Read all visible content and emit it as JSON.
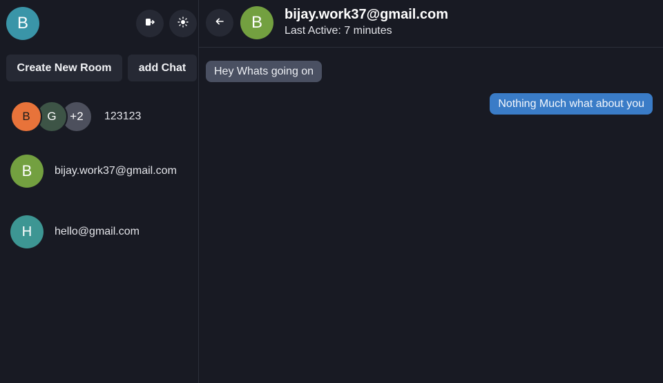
{
  "user": {
    "initial": "B"
  },
  "sidebar": {
    "create_room_label": "Create New Room",
    "add_chat_label": "add Chat",
    "group": {
      "avatars": [
        "B",
        "G",
        "+2"
      ],
      "name": "123123"
    },
    "chats": [
      {
        "initial": "B",
        "name": "bijay.work37@gmail.com"
      },
      {
        "initial": "H",
        "name": "hello@gmail.com"
      }
    ]
  },
  "conversation": {
    "contact_initial": "B",
    "contact_name": "bijay.work37@gmail.com",
    "last_active": "Last Active: 7 minutes",
    "messages": [
      {
        "direction": "incoming",
        "text": "Hey Whats going on"
      },
      {
        "direction": "outgoing",
        "text": "Nothing Much what about you"
      }
    ]
  },
  "icons": {
    "logout": "logout-icon",
    "theme": "sun-icon",
    "back": "arrow-left-icon"
  },
  "colors": {
    "background": "#181a23",
    "button": "#262934",
    "incoming_bubble": "#4a5062",
    "outgoing_bubble": "#3a7cc7",
    "avatar_user": "#3a95a8",
    "avatar_b": "#73a040",
    "avatar_h": "#3d9693",
    "avatar_group_b": "#e8733a",
    "avatar_group_g": "#3d5446"
  }
}
